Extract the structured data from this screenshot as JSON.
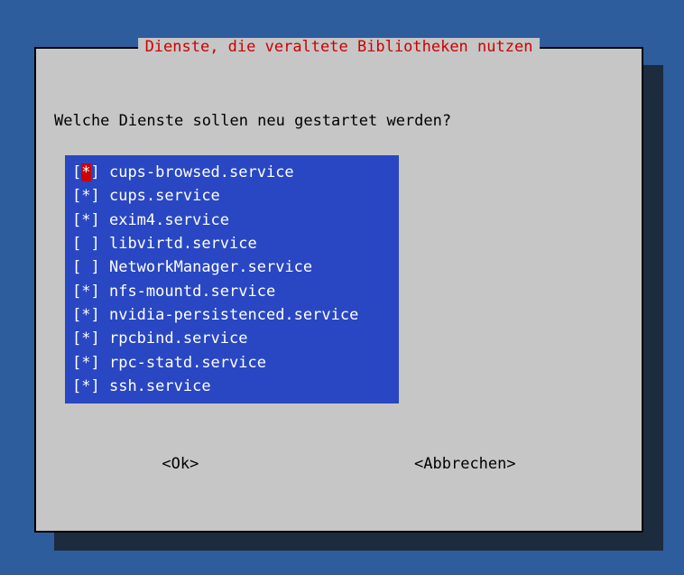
{
  "dialog": {
    "title": "Dienste, die veraltete Bibliotheken nutzen",
    "question": "Welche Dienste sollen neu gestartet werden?",
    "services": [
      {
        "name": "cups-browsed.service",
        "checked": true,
        "focused": true
      },
      {
        "name": "cups.service",
        "checked": true,
        "focused": false
      },
      {
        "name": "exim4.service",
        "checked": true,
        "focused": false
      },
      {
        "name": "libvirtd.service",
        "checked": false,
        "focused": false
      },
      {
        "name": "NetworkManager.service",
        "checked": false,
        "focused": false
      },
      {
        "name": "nfs-mountd.service",
        "checked": true,
        "focused": false
      },
      {
        "name": "nvidia-persistenced.service",
        "checked": true,
        "focused": false
      },
      {
        "name": "rpcbind.service",
        "checked": true,
        "focused": false
      },
      {
        "name": "rpc-statd.service",
        "checked": true,
        "focused": false
      },
      {
        "name": "ssh.service",
        "checked": true,
        "focused": false
      }
    ],
    "buttons": {
      "ok": "<Ok>",
      "cancel": "<Abbrechen>"
    }
  }
}
